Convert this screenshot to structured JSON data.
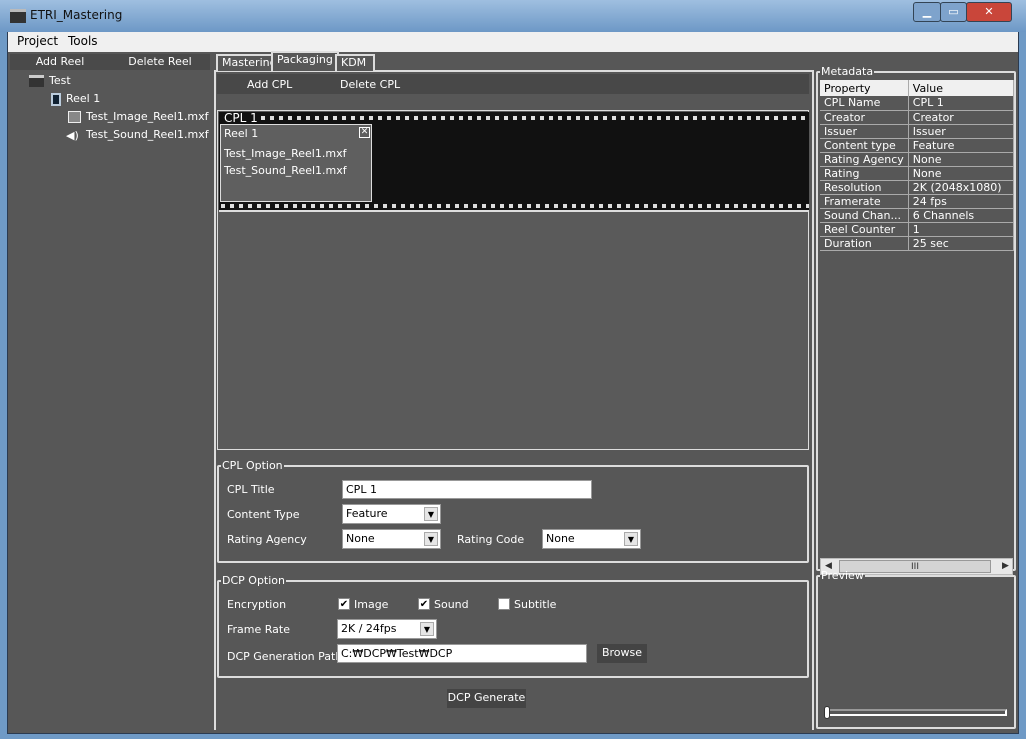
{
  "window": {
    "title": "ETRI_Mastering"
  },
  "menu": [
    "Project",
    "Tools"
  ],
  "left": {
    "add_reel": "Add Reel",
    "delete_reel": "Delete Reel",
    "tree": {
      "project": "Test",
      "reel": "Reel 1",
      "image": "Test_Image_Reel1.mxf",
      "sound": "Test_Sound_Reel1.mxf"
    }
  },
  "tabs": [
    "Mastering",
    "Packaging",
    "KDM"
  ],
  "active_tab": "Packaging",
  "packaging": {
    "add_cpl": "Add CPL",
    "delete_cpl": "Delete CPL",
    "cpl": {
      "name": "CPL 1",
      "reel": "Reel 1",
      "image": "Test_Image_Reel1.mxf",
      "sound": "Test_Sound_Reel1.mxf"
    }
  },
  "cpl_option": {
    "legend": "CPL Option",
    "title_label": "CPL Title",
    "title_value": "CPL 1",
    "content_type_label": "Content Type",
    "content_type_value": "Feature",
    "rating_agency_label": "Rating Agency",
    "rating_agency_value": "None",
    "rating_code_label": "Rating Code",
    "rating_code_value": "None"
  },
  "dcp_option": {
    "legend": "DCP Option",
    "encryption_label": "Encryption",
    "image": {
      "label": "Image",
      "checked": true
    },
    "sound": {
      "label": "Sound",
      "checked": true
    },
    "subtitle": {
      "label": "Subtitle",
      "checked": false
    },
    "frame_rate_label": "Frame Rate",
    "frame_rate_value": "2K / 24fps",
    "path_label": "DCP Generation Path",
    "path_value": "C:₩DCP₩Test₩DCP",
    "browse": "Browse"
  },
  "generate": "DCP Generate",
  "metadata": {
    "legend": "Metadata",
    "headers": [
      "Property",
      "Value"
    ],
    "rows": [
      [
        "CPL Name",
        "CPL 1"
      ],
      [
        "Creator",
        "Creator"
      ],
      [
        "Issuer",
        "Issuer"
      ],
      [
        "Content type",
        "Feature"
      ],
      [
        "Rating Agency",
        "None"
      ],
      [
        "Rating",
        "None"
      ],
      [
        "Resolution",
        "2K (2048x1080)"
      ],
      [
        "Framerate",
        "24 fps"
      ],
      [
        "Sound Chan...",
        "6 Channels"
      ],
      [
        "Reel Counter",
        "1"
      ],
      [
        "Duration",
        "25 sec"
      ]
    ],
    "scroll_grip": "III"
  },
  "preview": {
    "legend": "Preview",
    "slider_position": 0
  }
}
